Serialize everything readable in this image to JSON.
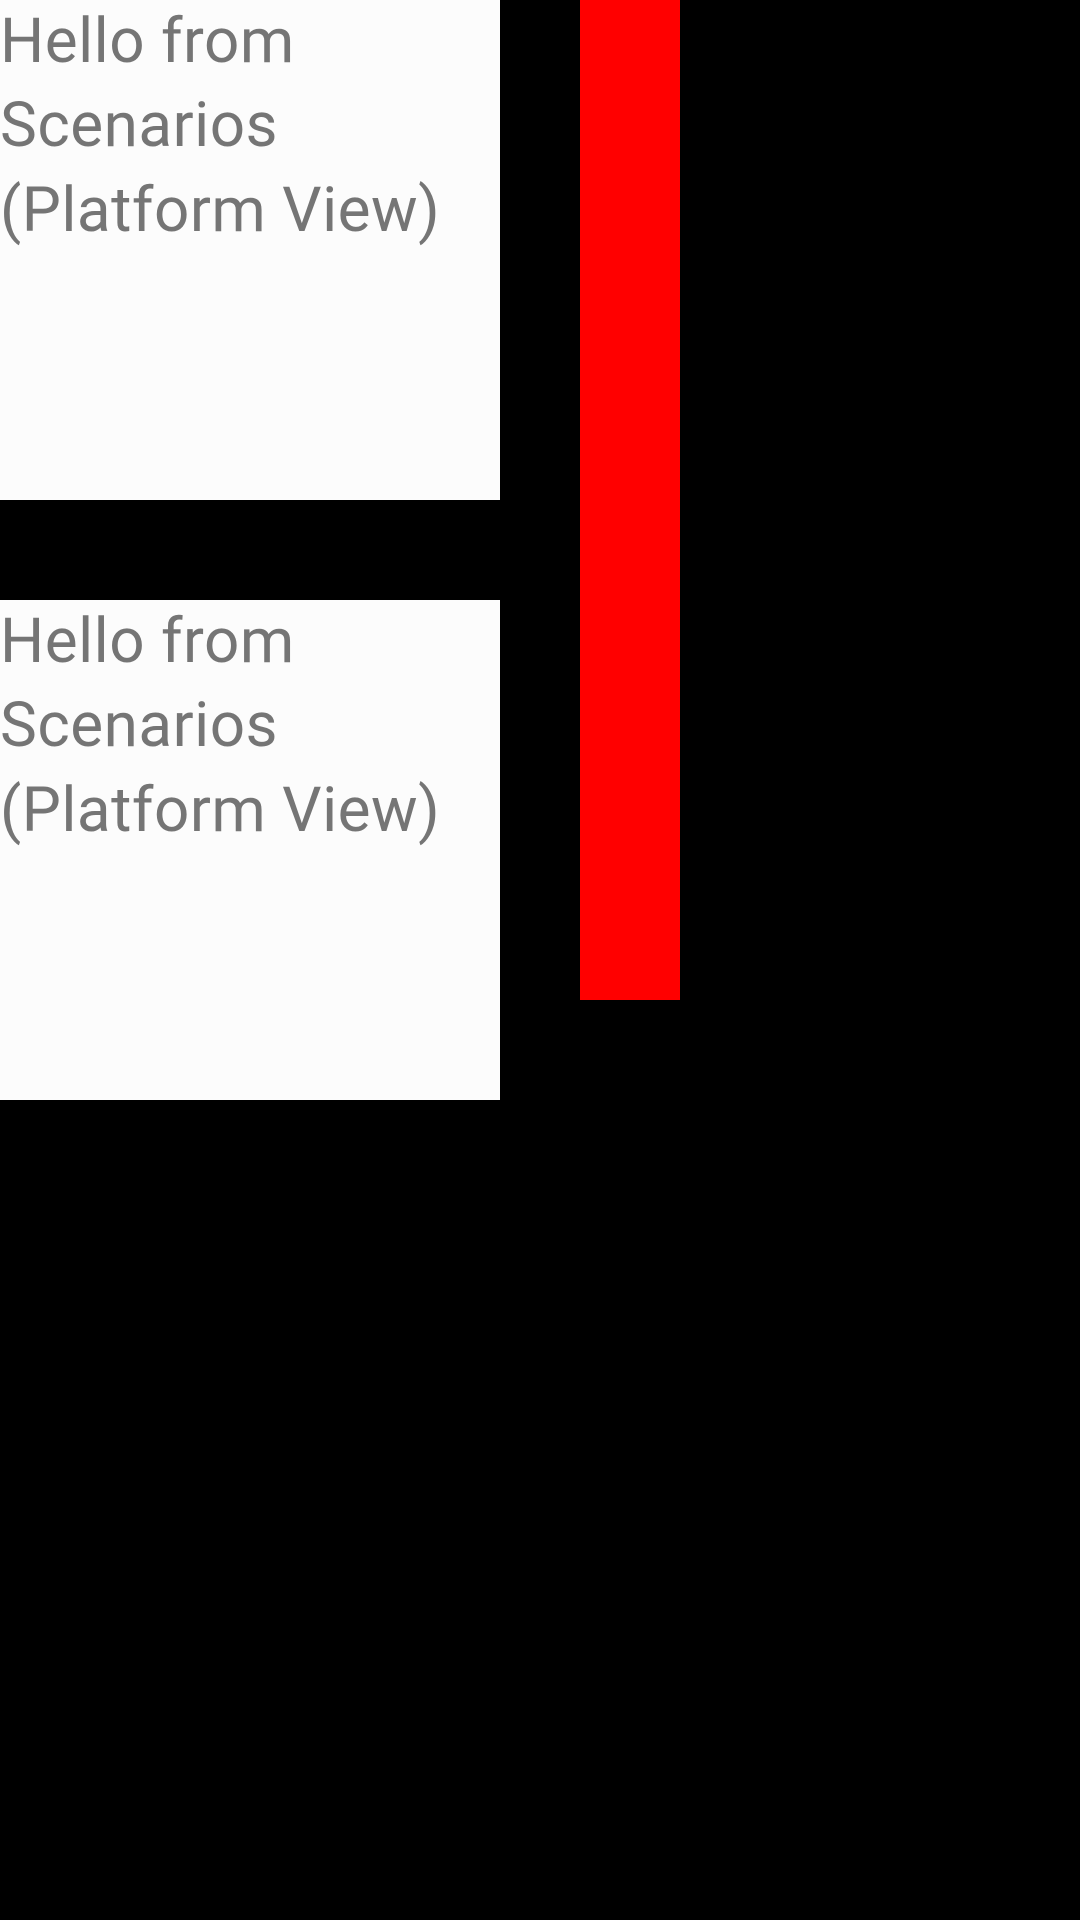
{
  "views": [
    {
      "text": "Hello from Scenarios (Platform View)"
    },
    {
      "text": "Hello from Scenarios (Platform View)"
    }
  ],
  "colors": {
    "background": "#000000",
    "card": "#fcfcfc",
    "text": "#757575",
    "accent": "#ff0000"
  }
}
